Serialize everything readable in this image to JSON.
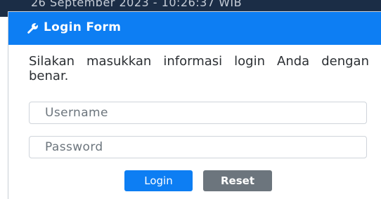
{
  "backdrop": {
    "text": "26 September 2023 - 10:26:37 WIB"
  },
  "modal": {
    "title": "Login Form",
    "title_icon": "wrench-icon",
    "header_color": "#0d7ef3",
    "instructions": "Silakan masukkan informasi login Anda dengan benar."
  },
  "form": {
    "username": {
      "value": "",
      "placeholder": "Username"
    },
    "password": {
      "value": "",
      "placeholder": "Password"
    },
    "login_label": "Login",
    "reset_label": "Reset",
    "login_color": "#0d7ef3",
    "reset_color": "#6c757d"
  }
}
